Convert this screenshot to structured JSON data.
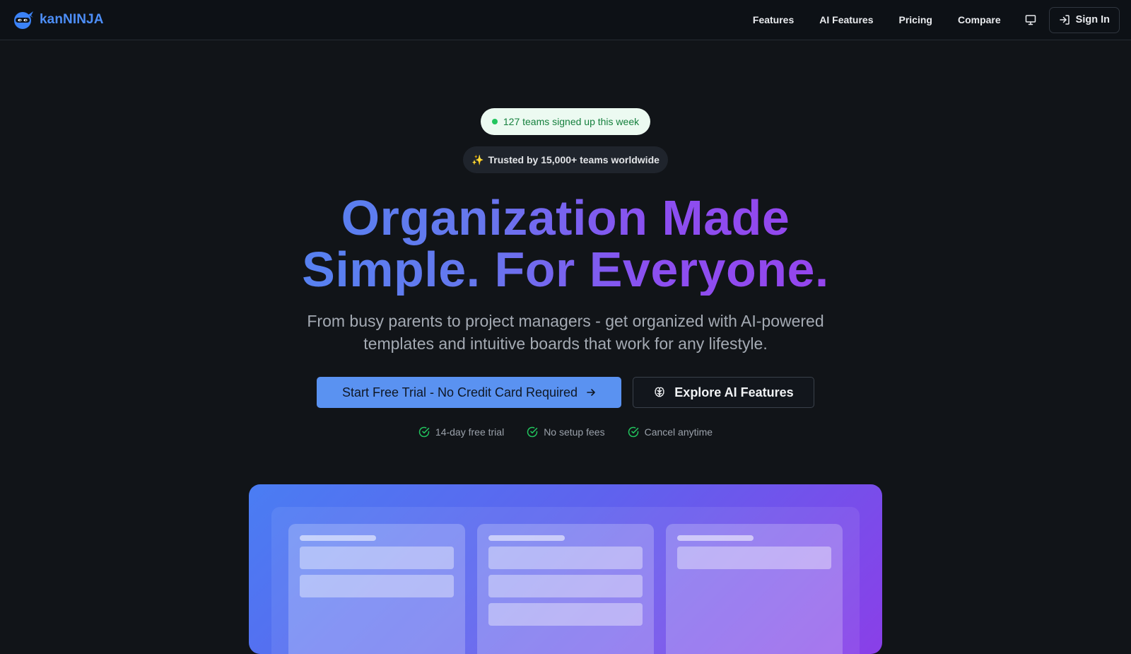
{
  "nav": {
    "brand": "kanNINJA",
    "brand_logo_icon": "ninja-logo-icon",
    "links": [
      "Features",
      "AI Features",
      "Pricing",
      "Compare"
    ],
    "display_icon": "monitor-icon",
    "signin_icon": "sign-in-icon",
    "signin_label": "Sign In"
  },
  "hero": {
    "signup_badge": "127 teams signed up this week",
    "trusted_icon": "✨",
    "trusted_badge": "Trusted by 15,000+ teams worldwide",
    "headline_line1": "Organization Made",
    "headline_line2": "Simple. For Everyone.",
    "subheadline": "From busy parents to project managers - get organized with AI-powered templates and intuitive boards that work for any lifestyle.",
    "cta_primary": "Start Free Trial - No Credit Card Required",
    "cta_primary_icon": "arrow-right-icon",
    "cta_secondary": "Explore AI Features",
    "cta_secondary_icon": "brain-icon",
    "benefits": [
      "14-day free trial",
      "No setup fees",
      "Cancel anytime"
    ],
    "benefit_icon": "check-circle-icon"
  },
  "colors": {
    "background": "#111418",
    "brand": "#4d8ef7",
    "primary_button": "#5a92f1",
    "success": "#22c55e",
    "gradient_start": "#4f86f2",
    "gradient_end": "#9a40ec"
  }
}
